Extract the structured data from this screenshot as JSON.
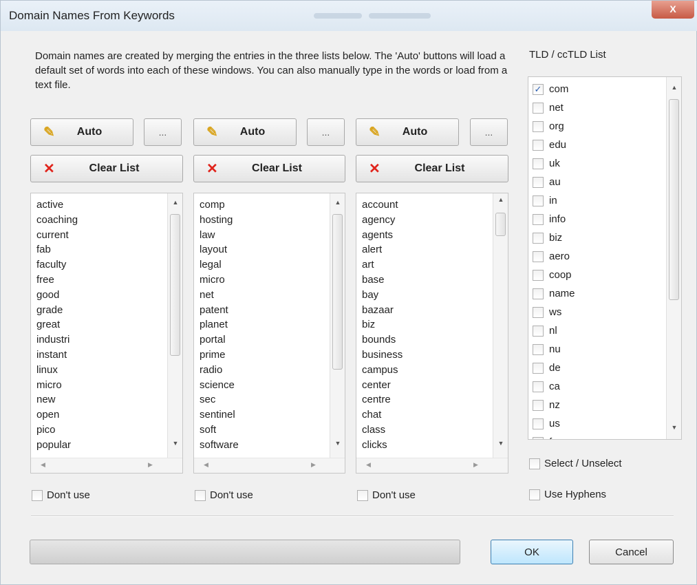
{
  "window": {
    "title": "Domain Names From Keywords",
    "close_label": "X"
  },
  "description": "Domain names are created by merging the entries in the three lists below. The 'Auto' buttons will load a default set of words into each of these windows. You can also manually type in the words or load from a text file.",
  "tld_heading": "TLD / ccTLD List",
  "columns": [
    {
      "auto_label": "Auto",
      "more_label": "...",
      "clear_label": "Clear List",
      "items": [
        "active",
        "coaching",
        "current",
        "fab",
        "faculty",
        "free",
        "good",
        "grade",
        "great",
        "industri",
        "instant",
        "linux",
        "micro",
        "new",
        "open",
        "pico",
        "popular"
      ],
      "dont_use_label": "Don't use"
    },
    {
      "auto_label": "Auto",
      "more_label": "...",
      "clear_label": "Clear List",
      "items": [
        "comp",
        "hosting",
        "law",
        "layout",
        "legal",
        "micro",
        "net",
        "patent",
        "planet",
        "portal",
        "prime",
        "radio",
        "science",
        "sec",
        "sentinel",
        "soft",
        "software"
      ],
      "dont_use_label": "Don't use"
    },
    {
      "auto_label": "Auto",
      "more_label": "...",
      "clear_label": "Clear List",
      "items": [
        "account",
        "agency",
        "agents",
        "alert",
        "art",
        "base",
        "bay",
        "bazaar",
        "biz",
        "bounds",
        "business",
        "campus",
        "center",
        "centre",
        "chat",
        "class",
        "clicks"
      ],
      "dont_use_label": "Don't use"
    }
  ],
  "tlds": [
    {
      "label": "com",
      "checked": true
    },
    {
      "label": "net",
      "checked": false
    },
    {
      "label": "org",
      "checked": false
    },
    {
      "label": "edu",
      "checked": false
    },
    {
      "label": "uk",
      "checked": false
    },
    {
      "label": "au",
      "checked": false
    },
    {
      "label": "in",
      "checked": false
    },
    {
      "label": "info",
      "checked": false
    },
    {
      "label": "biz",
      "checked": false
    },
    {
      "label": "aero",
      "checked": false
    },
    {
      "label": "coop",
      "checked": false
    },
    {
      "label": "name",
      "checked": false
    },
    {
      "label": "ws",
      "checked": false
    },
    {
      "label": "nl",
      "checked": false
    },
    {
      "label": "nu",
      "checked": false
    },
    {
      "label": "de",
      "checked": false
    },
    {
      "label": "ca",
      "checked": false
    },
    {
      "label": "nz",
      "checked": false
    },
    {
      "label": "us",
      "checked": false
    },
    {
      "label": "fr",
      "checked": false
    }
  ],
  "select_unselect_label": "Select / Unselect",
  "use_hyphens_label": "Use Hyphens",
  "ok_label": "OK",
  "cancel_label": "Cancel",
  "progress": 0,
  "check_mark": "✓",
  "colors": {
    "check": "#2a5db0",
    "clear_x": "#e0241c",
    "pencil": "#d9a520"
  }
}
